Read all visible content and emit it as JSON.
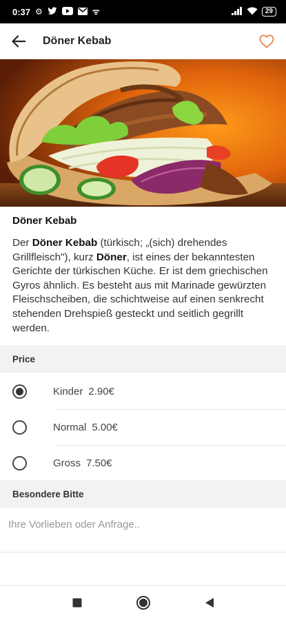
{
  "status_bar": {
    "time": "0:37",
    "left_icons": [
      "settings-icon",
      "twitter-icon",
      "youtube-icon",
      "gmail-icon",
      "signal-question-icon"
    ],
    "right_icons": [
      "signal-icon",
      "wifi-icon"
    ],
    "battery": "29"
  },
  "app_bar": {
    "title": "Döner Kebab",
    "back_icon": "arrow-left-icon",
    "favorite_icon": "heart-outline-icon",
    "accent_color": "#e8834a"
  },
  "product": {
    "title": "Döner Kebab",
    "description_parts": {
      "p1": "Der ",
      "b1": "Döner Kebab",
      "p2": " (türkisch; „(sich) drehendes Grillfleisch\"), kurz ",
      "b2": "Döner",
      "p3": ", ist eines der bekanntesten Gerichte der türkischen Küche. Er ist dem griechischen Gyros ähnlich. Es besteht aus mit Marinade gewürzten Fleischscheiben, die schichtweise auf einen senkrecht stehenden Drehspieß gesteckt und seitlich gegrillt werden."
    }
  },
  "price": {
    "header": "Price",
    "options": [
      {
        "name": "Kinder",
        "price": "2.90€",
        "selected": true
      },
      {
        "name": "Normal",
        "price": "5.00€",
        "selected": false
      },
      {
        "name": "Gross",
        "price": "7.50€",
        "selected": false
      }
    ]
  },
  "special_request": {
    "header": "Besondere Bitte",
    "placeholder": "Ihre Vorlieben oder Anfrage..",
    "value": ""
  },
  "nav_bar": {
    "icons": [
      "recents-square-icon",
      "home-circle-icon",
      "back-triangle-icon"
    ]
  }
}
